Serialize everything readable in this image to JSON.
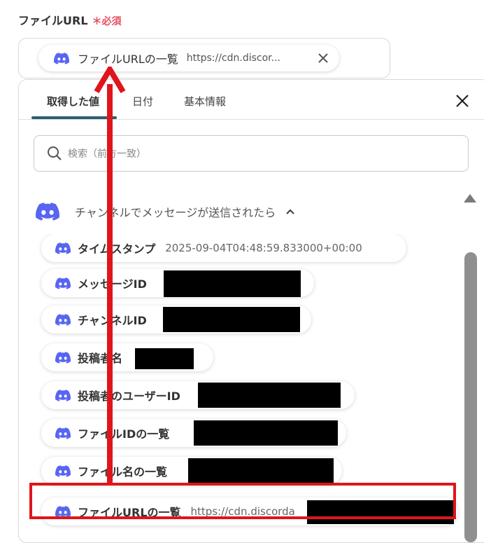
{
  "field": {
    "label": "ファイルURL",
    "required_mark": "＊",
    "required_text": "必須",
    "chip_label": "ファイルURLの一覧",
    "chip_value": "https://cdn.discor...",
    "chip_remove_icon": "close-icon"
  },
  "tabs": [
    {
      "label": "取得した値",
      "active": true
    },
    {
      "label": "日付",
      "active": false
    },
    {
      "label": "基本情報",
      "active": false
    }
  ],
  "panel_close_icon": "close-icon",
  "search": {
    "placeholder": "検索（前方一致）"
  },
  "section": {
    "title": "チャンネルでメッセージが送信されたら",
    "icon": "discord-icon",
    "toggle_icon": "chevron-up-icon"
  },
  "items": [
    {
      "label": "タイムスタンプ",
      "value": "2025-09-04T04:48:59.833000+00:00"
    },
    {
      "label": "メッセージID",
      "value": ""
    },
    {
      "label": "チャンネルID",
      "value": ""
    },
    {
      "label": "投稿者名",
      "value": ""
    },
    {
      "label": "投稿者のユーザーID",
      "value": ""
    },
    {
      "label": "ファイルIDの一覧",
      "value": ""
    },
    {
      "label": "ファイル名の一覧",
      "value": ""
    },
    {
      "label": "ファイルURLの一覧",
      "value": "https://cdn.discorda"
    }
  ],
  "colors": {
    "accent": "#2c5e72",
    "required": "#e5505e",
    "discord": "#5865f2",
    "annotation": "#e0141c"
  }
}
